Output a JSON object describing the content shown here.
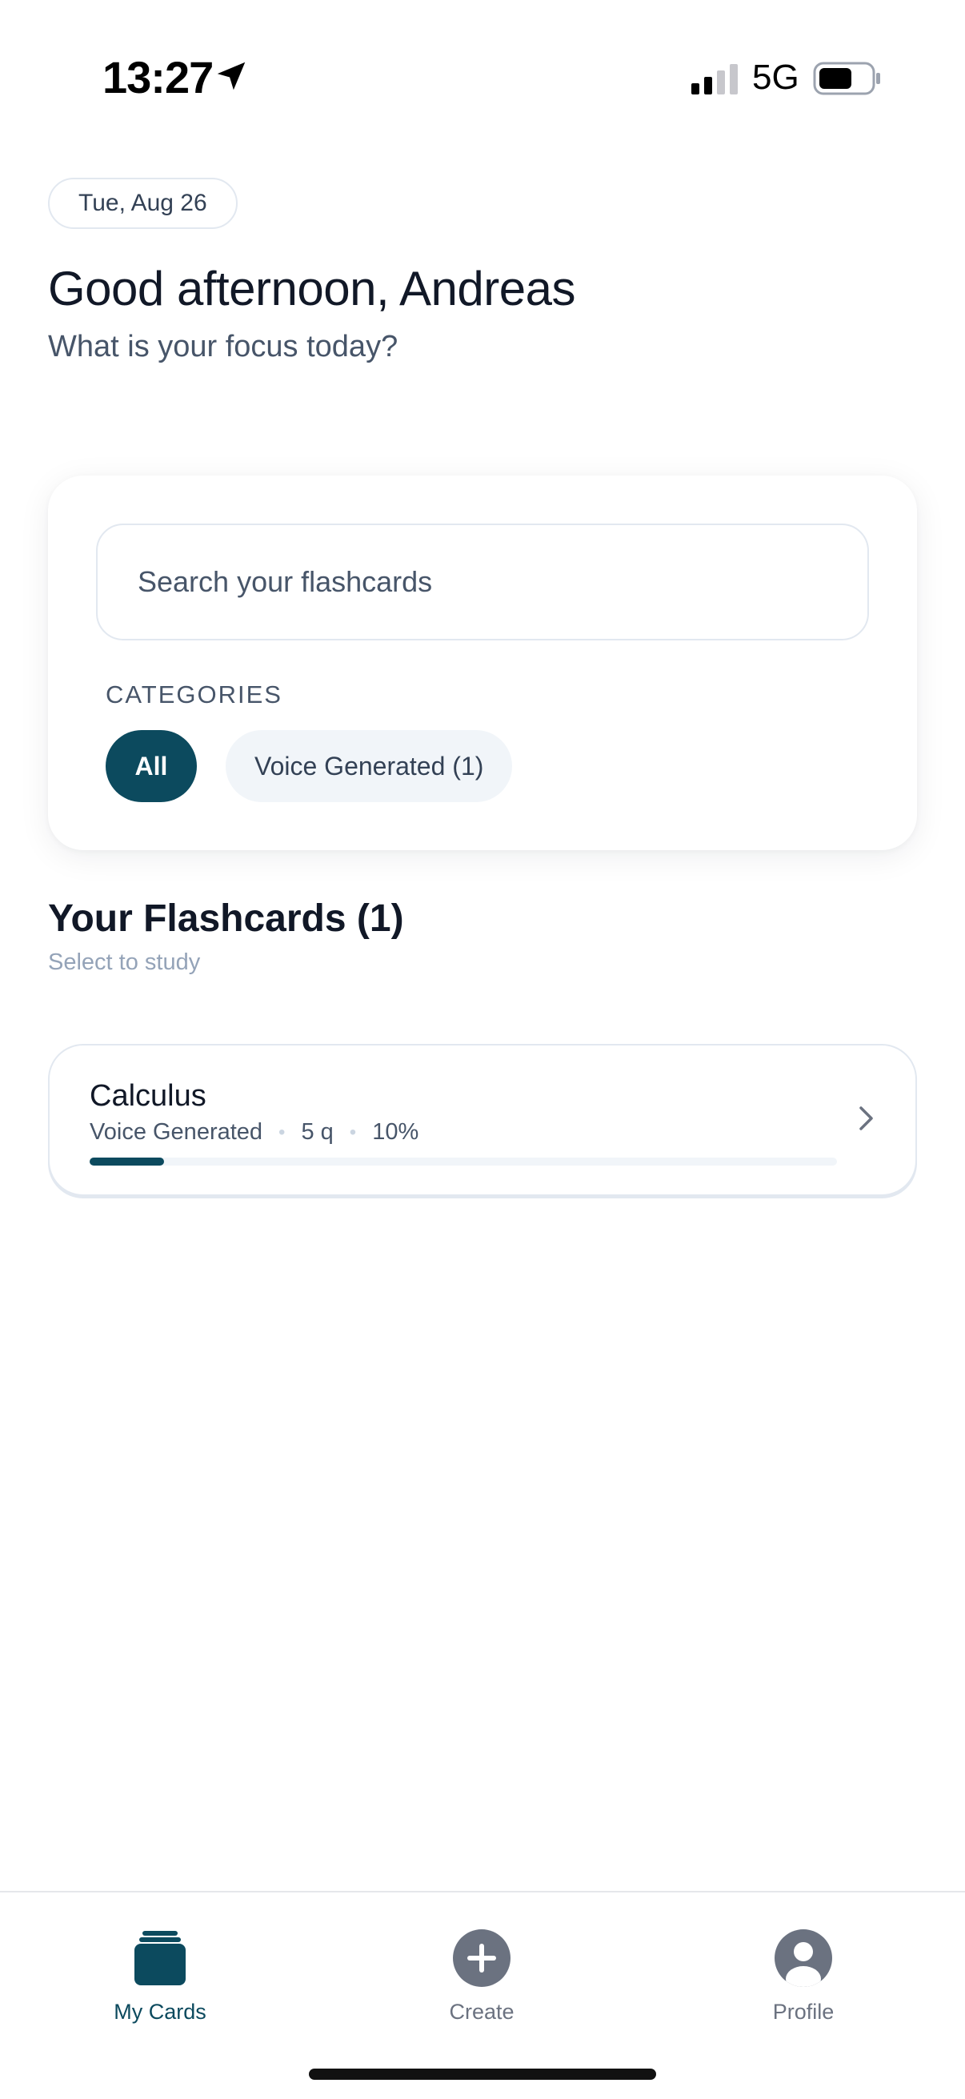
{
  "status_bar": {
    "time": "13:27",
    "network": "5G",
    "icons": [
      "location-arrow-icon",
      "cellular-signal-icon",
      "battery-icon"
    ]
  },
  "header": {
    "date": "Tue, Aug 26",
    "greeting": "Good afternoon, Andreas",
    "subtitle": "What is your focus today?"
  },
  "search": {
    "placeholder": "Search your flashcards"
  },
  "categories": {
    "label": "CATEGORIES",
    "items": [
      {
        "label": "All",
        "selected": true
      },
      {
        "label": "Voice Generated (1)",
        "selected": false
      }
    ]
  },
  "flashcards_section": {
    "title": "Your Flashcards (1)",
    "subtitle": "Select to study"
  },
  "flashcards": [
    {
      "title": "Calculus",
      "category": "Voice Generated",
      "questions": "5 q",
      "progress_label": "10%",
      "progress_fraction": 0.1
    }
  ],
  "tab_bar": {
    "tabs": [
      {
        "label": "My Cards",
        "icon": "card-stack-icon",
        "active": true
      },
      {
        "label": "Create",
        "icon": "plus-circle-icon",
        "active": false
      },
      {
        "label": "Profile",
        "icon": "user-avatar-icon",
        "active": false
      }
    ]
  },
  "colors": {
    "accent": "#0c4a5e",
    "chip_inactive_bg": "#f1f5f9",
    "text_secondary": "#475569",
    "muted": "#94a3b8"
  }
}
